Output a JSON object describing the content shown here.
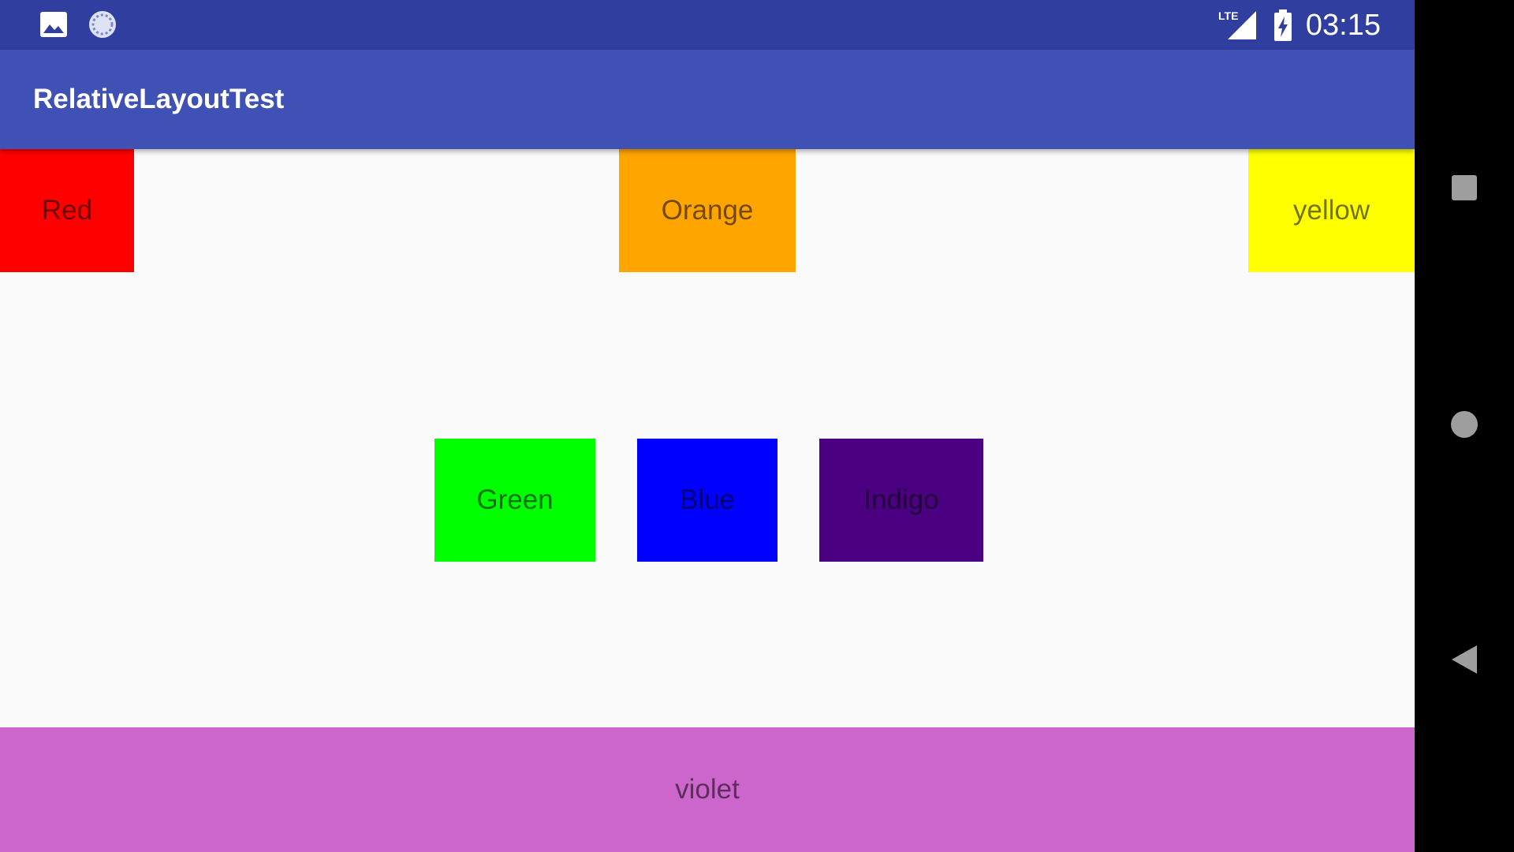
{
  "status_bar": {
    "time": "03:15",
    "network_label": "LTE",
    "icons": [
      "image-icon",
      "sync-icon",
      "lte-signal-icon",
      "battery-charging-icon"
    ]
  },
  "app_bar": {
    "title": "RelativeLayoutTest"
  },
  "boxes": {
    "red": {
      "label": "Red",
      "color": "#ff0000"
    },
    "orange": {
      "label": "Orange",
      "color": "#ffa500"
    },
    "yellow": {
      "label": "yellow",
      "color": "#ffff00"
    },
    "green": {
      "label": "Green",
      "color": "#00ff00"
    },
    "blue": {
      "label": "Blue",
      "color": "#0000ff"
    },
    "indigo": {
      "label": "Indigo",
      "color": "#4b0082"
    },
    "violet": {
      "label": "violet",
      "color": "#cc66cc"
    }
  },
  "colors": {
    "status_bar": "#303f9f",
    "app_bar": "#3f51b5",
    "background": "#fafafa",
    "nav_bar": "#000000"
  },
  "nav_bar": {
    "buttons": [
      "recents-button",
      "home-button",
      "back-button"
    ]
  }
}
